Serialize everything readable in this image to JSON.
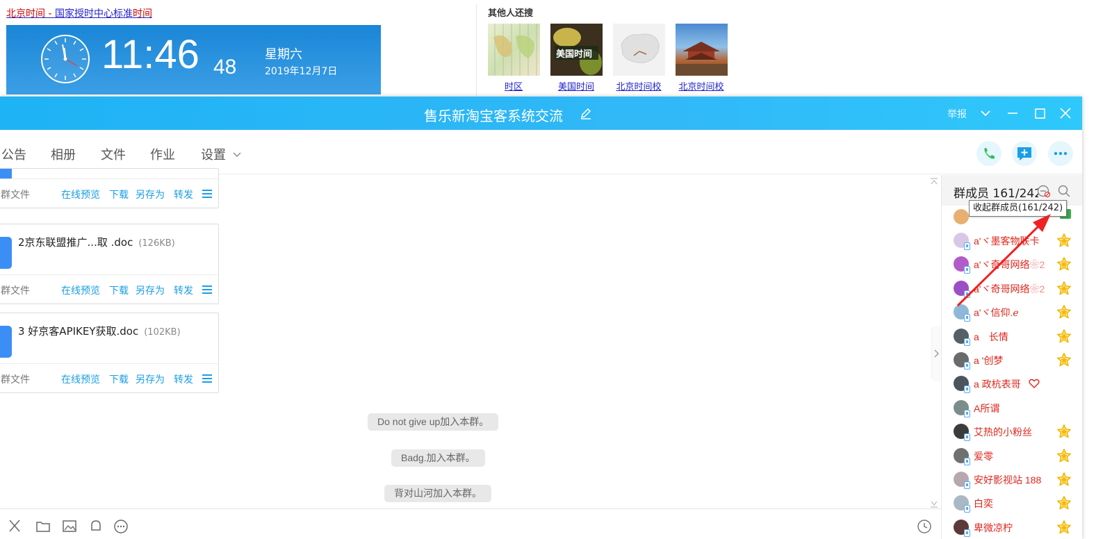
{
  "web": {
    "link_left": "北京时间 - ",
    "link_middle": "国家授时中心标准",
    "link_right": "时间",
    "clock": {
      "time": "11:46",
      "seconds": "48",
      "weekday": "星期六",
      "date": "2019年12月7日"
    },
    "other_search_title": "其他人还搜",
    "thumbs": [
      {
        "label": "时区"
      },
      {
        "label": "美国时间",
        "caption": "美国时间"
      },
      {
        "label": "北京时间校"
      },
      {
        "label": "北京时间校"
      }
    ]
  },
  "window": {
    "title": "售乐新淘宝客系统交流",
    "report": "举报",
    "tabs": [
      "公告",
      "相册",
      "文件",
      "作业",
      "设置"
    ]
  },
  "files": [
    {
      "name": "",
      "size": "",
      "source": "群文件"
    },
    {
      "name": "2京东联盟推广...取 .doc",
      "size": "(126KB)",
      "source": "群文件"
    },
    {
      "name": "3 好京客APIKEY获取.doc",
      "size": "(102KB)",
      "source": "群文件"
    }
  ],
  "file_actions": {
    "preview": "在线预览",
    "download": "下载",
    "save_as": "另存为",
    "forward": "转发"
  },
  "system_messages": [
    "Do not give up加入本群。",
    "Badg.加入本群。",
    "背对山河加入本群。"
  ],
  "members": {
    "title": "群成员 161/242",
    "tooltip": "收起群成员(161/242)",
    "list": [
      {
        "name": "a'ヾ墨客物联卡",
        "extra": "",
        "star": true,
        "color": "#d9c7e8"
      },
      {
        "name": "a'ヾ奇哥网络",
        "extra": "❀2",
        "star": true,
        "color": "#b35cc9"
      },
      {
        "name": "a'ヾ奇哥网络",
        "extra": "❀2",
        "star": true,
        "color": "#9c4fc4"
      },
      {
        "name": "a'ヾ信仰.ℯ",
        "extra": "",
        "star": true,
        "color": "#8fb8d6"
      },
      {
        "name": "a　长情",
        "extra": "",
        "star": true,
        "color": "#555f66"
      },
      {
        "name": "a '创梦",
        "extra": "",
        "star": true,
        "color": "#6b6b6b"
      },
      {
        "name": "a 政杭表哥",
        "extra": "",
        "star": false,
        "heart": true,
        "color": "#4a5560"
      },
      {
        "name": "A所谓",
        "extra": "",
        "star": false,
        "color": "#7c8c8a"
      },
      {
        "name": "艾热的小粉丝",
        "extra": "",
        "star": true,
        "color": "#3c3c3c"
      },
      {
        "name": "爱零",
        "extra": "",
        "star": true,
        "color": "#707070"
      },
      {
        "name": "安好影视站 188",
        "extra": "",
        "star": true,
        "color": "#b8a7b0"
      },
      {
        "name": "白奕",
        "extra": "",
        "star": true,
        "color": "#aab8c4"
      },
      {
        "name": "卑微凉柠",
        "extra": "",
        "star": true,
        "color": "#5c3a3a"
      }
    ]
  },
  "colors": {
    "title_bar": "#1eb3f5",
    "link_blue": "#1a9ee6",
    "member_red": "#e0261c",
    "star": "#f5b800",
    "arrow": "#ee2222"
  }
}
